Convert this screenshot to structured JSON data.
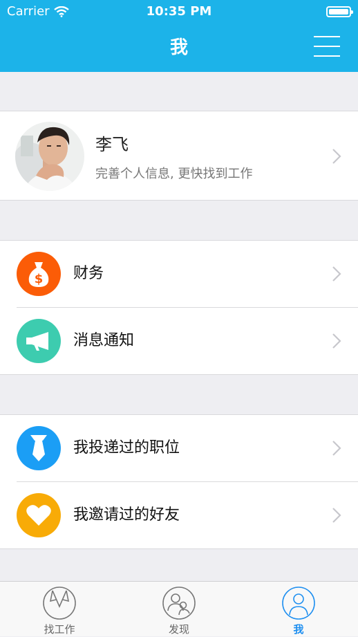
{
  "status_bar": {
    "carrier": "Carrier",
    "time": "10:35 PM"
  },
  "nav": {
    "title": "我"
  },
  "profile": {
    "name": "李飞",
    "subtitle": "完善个人信息, 更快找到工作"
  },
  "menu": {
    "finance": {
      "label": "财务",
      "icon": "money-bag-icon",
      "color": "#fb5c07"
    },
    "notifications": {
      "label": "消息通知",
      "icon": "megaphone-icon",
      "color": "#3dccaf"
    },
    "applied_jobs": {
      "label": "我投递过的职位",
      "icon": "necktie-icon",
      "color": "#1b9ef5"
    },
    "invited_friends": {
      "label": "我邀请过的好友",
      "icon": "heart-icon",
      "color": "#f8ab07"
    }
  },
  "tabbar": {
    "tabs": [
      {
        "label": "找工作",
        "icon": "shirt-collar-icon",
        "active": false
      },
      {
        "label": "发现",
        "icon": "people-icon",
        "active": false
      },
      {
        "label": "我",
        "icon": "person-icon",
        "active": true
      }
    ]
  },
  "colors": {
    "header": "#1cb3e9",
    "accent": "#1e8ff0"
  }
}
